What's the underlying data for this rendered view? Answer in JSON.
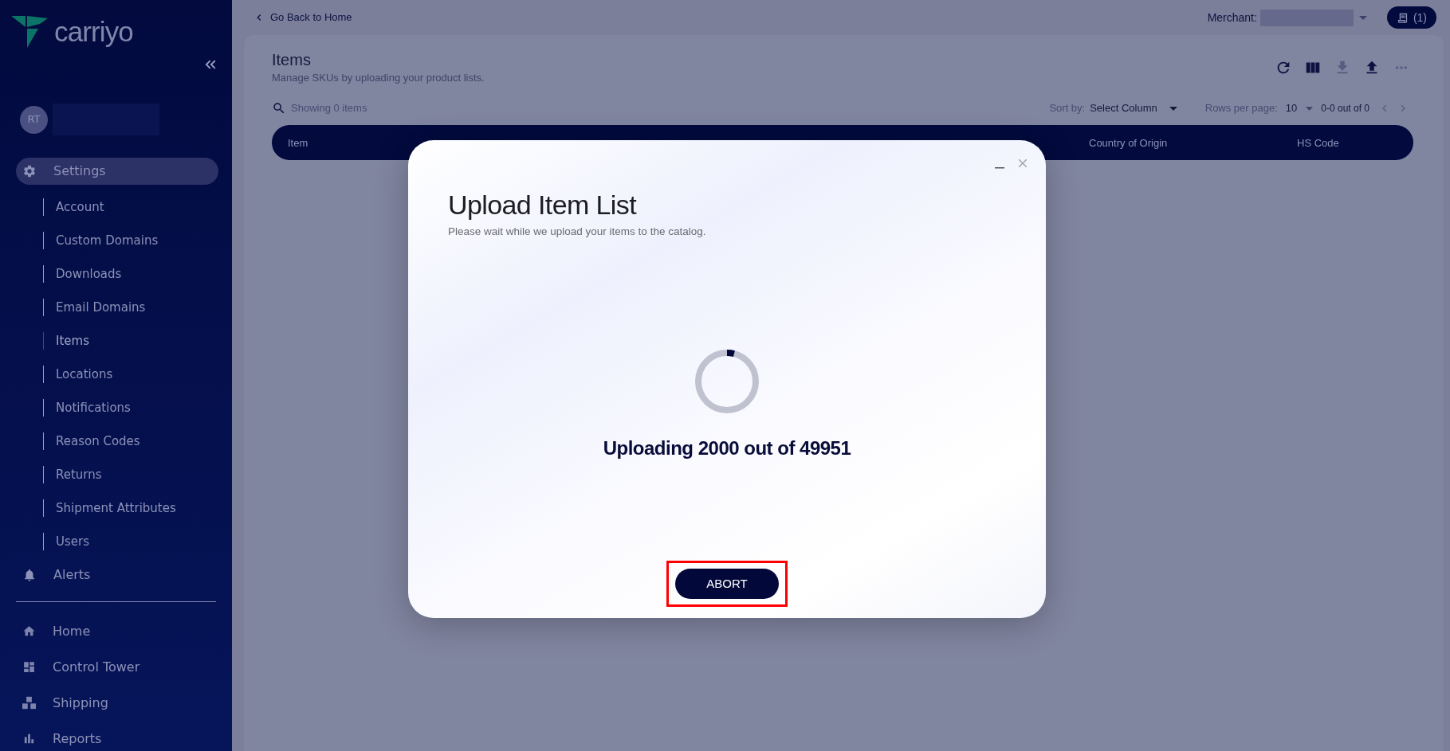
{
  "sidebar": {
    "logo": {
      "text": "carriyo"
    },
    "user": {
      "initials": "RT"
    },
    "menu": [
      {
        "label": "Settings",
        "selected": true,
        "expanded": true,
        "children": [
          {
            "label": "Account",
            "selected": false
          },
          {
            "label": "Custom Domains",
            "selected": false
          },
          {
            "label": "Downloads",
            "selected": false
          },
          {
            "label": "Email Domains",
            "selected": false
          },
          {
            "label": "Items",
            "selected": true
          },
          {
            "label": "Locations",
            "selected": false
          },
          {
            "label": "Notifications",
            "selected": false
          },
          {
            "label": "Reason Codes",
            "selected": false
          },
          {
            "label": "Returns",
            "selected": false
          },
          {
            "label": "Shipment Attributes",
            "selected": false
          },
          {
            "label": "Users",
            "selected": false
          }
        ]
      },
      {
        "label": "Alerts",
        "selected": false,
        "expanded": false
      }
    ],
    "nav_items": [
      {
        "label": "Home",
        "selected": false
      },
      {
        "label": "Control Tower",
        "selected": false
      },
      {
        "label": "Shipping",
        "selected": false
      },
      {
        "label": "Reports",
        "selected": false
      }
    ]
  },
  "top_bar": {
    "back_link": "Go Back to Home",
    "merchant": {
      "label": "Merchant:"
    },
    "tasks_button": "(1)"
  },
  "page": {
    "title": "Items",
    "subtitle": "Manage SKUs by uploading your product lists.",
    "toolbar": [
      {
        "disabled": false
      },
      {
        "disabled": false
      },
      {
        "disabled": true
      },
      {
        "disabled": false
      },
      {
        "disabled": true
      }
    ],
    "search": {
      "placeholder": "Showing 0 items"
    },
    "sort": {
      "label": "Sort by:",
      "value": "Select Column"
    },
    "rows_per_page": {
      "label": "Rows per page:",
      "value": "10"
    },
    "pagination": {
      "range": "0-0 out of 0"
    },
    "table": {
      "columns": [
        {
          "label": "Item"
        },
        {
          "label": "Country of Origin"
        },
        {
          "label": "HS Code"
        }
      ]
    }
  },
  "modal": {
    "title": "Upload Item List",
    "subtitle": "Please wait while we upload your items to the catalog.",
    "progress": {
      "level": 0.04
    },
    "status": "Uploading 2000 out of 49951",
    "abort_button": {
      "label": "ABORT",
      "highlighted": true
    }
  }
}
